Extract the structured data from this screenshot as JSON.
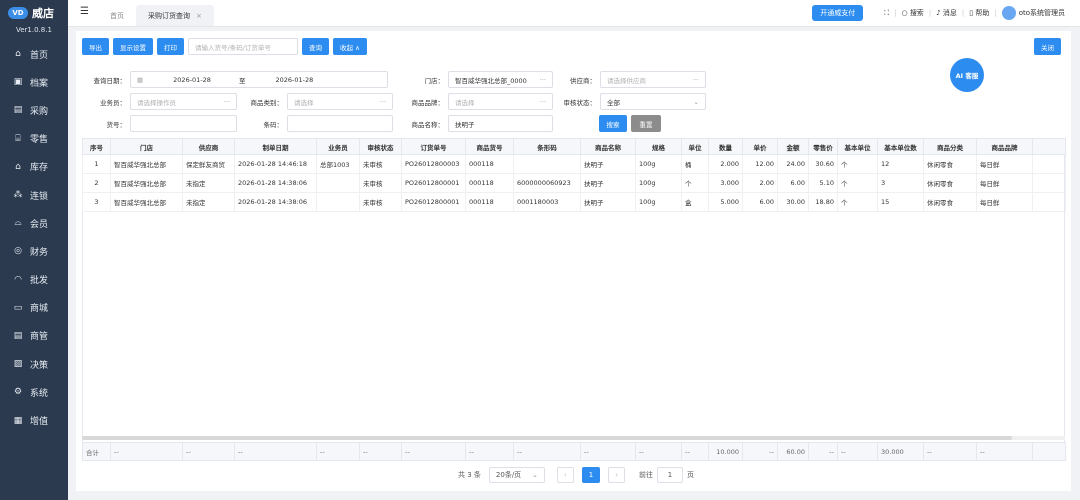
{
  "app": {
    "name": "威店",
    "version": "Ver1.0.8.1",
    "logo_text": "VD"
  },
  "sidebar": {
    "items": [
      {
        "label": "首页",
        "icon": "⌂"
      },
      {
        "label": "档案",
        "icon": "▣"
      },
      {
        "label": "采购",
        "icon": "▤"
      },
      {
        "label": "零售",
        "icon": "⌸"
      },
      {
        "label": "库存",
        "icon": "⌂"
      },
      {
        "label": "连锁",
        "icon": "⁂"
      },
      {
        "label": "会员",
        "icon": "⌓"
      },
      {
        "label": "财务",
        "icon": "◎"
      },
      {
        "label": "批发",
        "icon": "◠"
      },
      {
        "label": "商城",
        "icon": "▭"
      },
      {
        "label": "商管",
        "icon": "▤"
      },
      {
        "label": "决策",
        "icon": "▨"
      },
      {
        "label": "系统",
        "icon": "⚙"
      },
      {
        "label": "增值",
        "icon": "▦"
      }
    ]
  },
  "tabs": [
    {
      "label": "首页"
    },
    {
      "label": "采购订货查询",
      "close": "×"
    }
  ],
  "topbar": {
    "pay": "开通威支付",
    "search": "搜索",
    "messages": "消息",
    "help": "帮助",
    "user": "oto系统管理员"
  },
  "toolbar": {
    "export": "导出",
    "display_settings": "显示设置",
    "print": "打印",
    "search_placeholder": "请输入货号/条码/订货单号",
    "query": "查询",
    "collapse": "收起 ∧",
    "close": "关闭"
  },
  "ai": "AI 客服",
  "filters": {
    "date_label": "查询日期：",
    "date_from": "2026-01-28",
    "to": "至",
    "date_to": "2026-01-28",
    "store_label": "门店：",
    "store_value": "智百威华强北总部_0000",
    "supplier_label": "供应商：",
    "supplier_placeholder": "请选择供应商",
    "salesman_label": "业务员：",
    "salesman_placeholder": "请选择操作员",
    "category_label": "商品类别：",
    "category_placeholder": "请选择",
    "brand_label": "商品品牌：",
    "brand_placeholder": "请选择",
    "audit_label": "审核状态：",
    "audit_value": "全部",
    "code_label": "货号：",
    "barcode_label": "条码：",
    "name_label": "商品名称：",
    "name_value": "扶明子",
    "search": "搜索",
    "reset": "重置"
  },
  "table": {
    "headers": [
      "序号",
      "门店",
      "供应商",
      "制单日期",
      "业务员",
      "审核状态",
      "订货单号",
      "商品货号",
      "条形码",
      "商品名称",
      "规格",
      "单位",
      "数量",
      "单价",
      "金额",
      "零售价",
      "基本单位",
      "基本单位数",
      "商品分类",
      "商品品牌"
    ],
    "rows": [
      [
        "1",
        "智百威华强北总部",
        "保定鲜友商贸",
        "2026-01-28 14:46:18",
        "总部1003",
        "未审核",
        "PO26012800003",
        "000118",
        "",
        "扶明子",
        "100g",
        "桶",
        "2.000",
        "12.00",
        "24.00",
        "30.60",
        "个",
        "12",
        "休闲零食",
        "每日鲜"
      ],
      [
        "2",
        "智百威华强北总部",
        "未指定",
        "2026-01-28 14:38:06",
        "",
        "未审核",
        "PO26012800001",
        "000118",
        "6000000060923",
        "扶明子",
        "100g",
        "个",
        "3.000",
        "2.00",
        "6.00",
        "5.10",
        "个",
        "3",
        "休闲零食",
        "每日鲜"
      ],
      [
        "3",
        "智百威华强北总部",
        "未指定",
        "2026-01-28 14:38:06",
        "",
        "未审核",
        "PO26012800001",
        "000118",
        "0001180003",
        "扶明子",
        "100g",
        "盒",
        "5.000",
        "6.00",
        "30.00",
        "18.80",
        "个",
        "15",
        "休闲零食",
        "每日鲜"
      ]
    ],
    "footer": [
      "合计",
      "--",
      "--",
      "--",
      "--",
      "--",
      "--",
      "--",
      "--",
      "--",
      "--",
      "--",
      "10.000",
      "--",
      "60.00",
      "--",
      "--",
      "30.000",
      "--",
      "--"
    ]
  },
  "pager": {
    "total": "共 3 条",
    "page_size": "20条/页",
    "prev": "‹",
    "page": "1",
    "next": "›",
    "goto": "前往",
    "goto_value": "1",
    "unit": "页"
  }
}
